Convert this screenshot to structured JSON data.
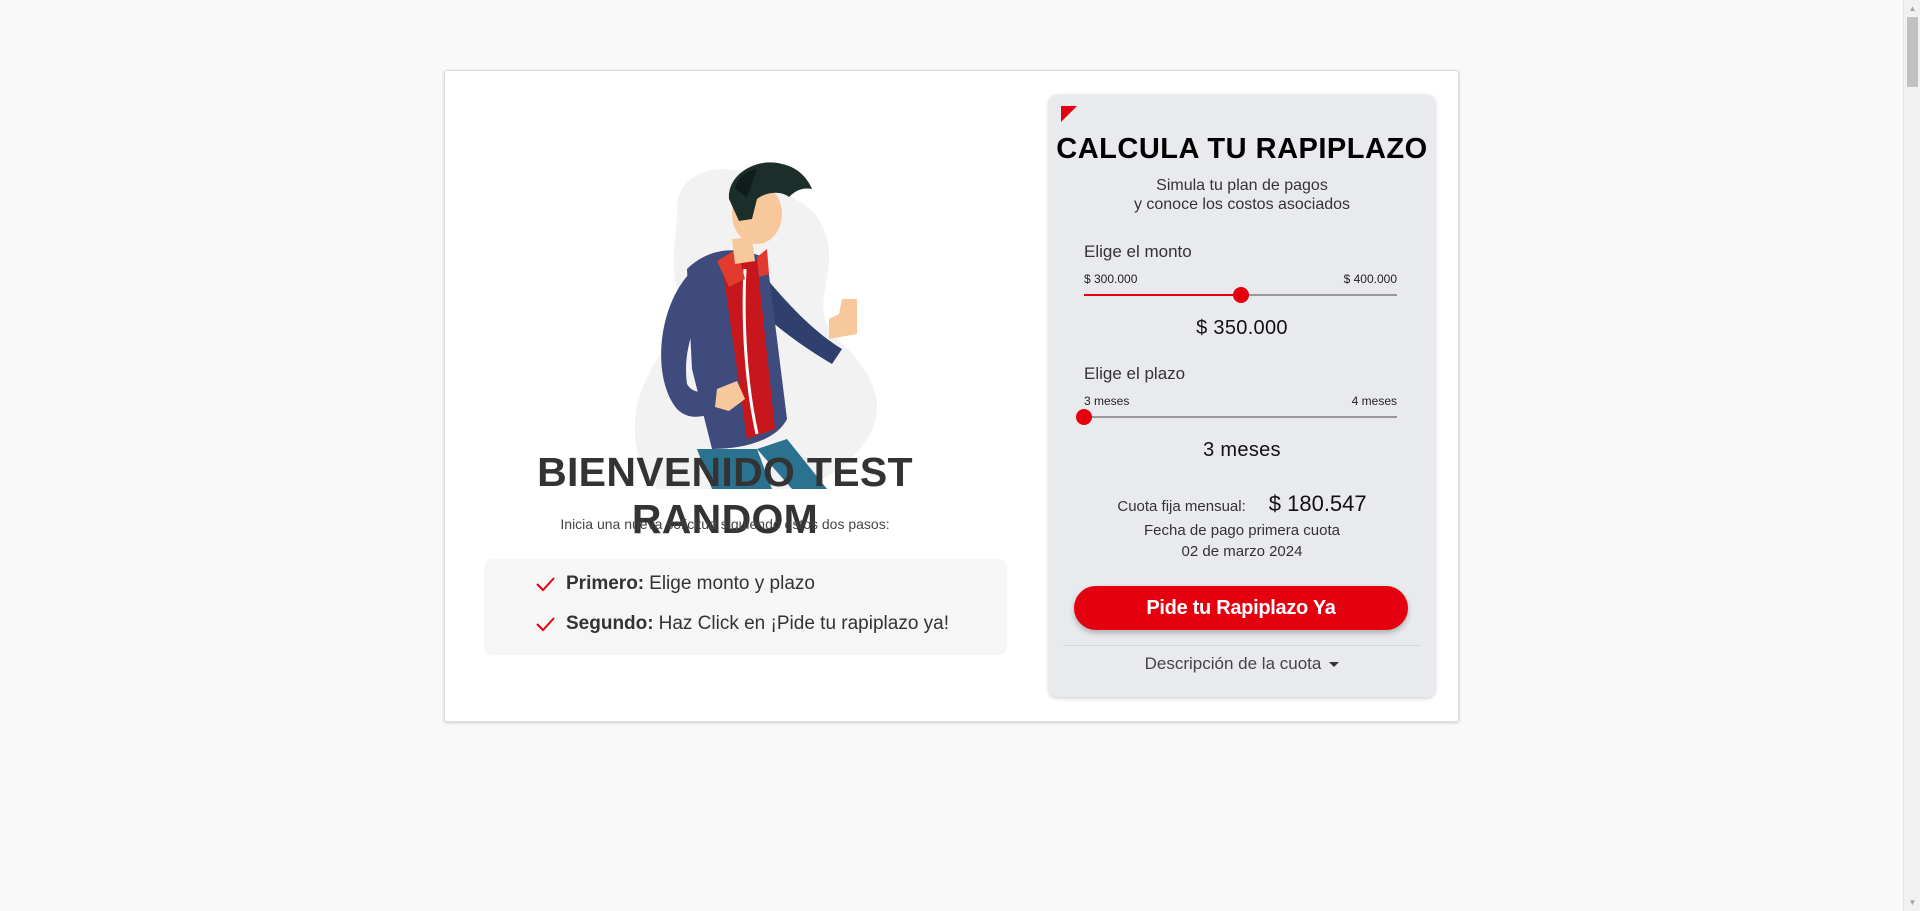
{
  "welcome": {
    "title": "BIENVENIDO TEST RANDOM",
    "subtitle": "Inicia una nueva solicitud siguiendo estos dos pasos:",
    "steps": [
      {
        "bold": "Primero:",
        "text": "Elige monto y plazo",
        "icon": "check-icon"
      },
      {
        "bold": "Segundo:",
        "text": "Haz Click en ¡Pide tu rapiplazo ya!",
        "icon": "check-icon"
      }
    ]
  },
  "calculator": {
    "title": "CALCULA TU RAPIPLAZO",
    "subtitle_line1": "Simula tu plan de pagos",
    "subtitle_line2": "y conoce los costos asociados",
    "amount": {
      "label": "Elige el monto",
      "min_label": "$ 300.000",
      "max_label": "$ 400.000",
      "value_label": "$ 350.000",
      "fraction": 0.5
    },
    "term": {
      "label": "Elige el plazo",
      "min_label": "3 meses",
      "max_label": "4 meses",
      "value_label": "3 meses",
      "fraction": 0.0
    },
    "cuota_label": "Cuota fija mensual:",
    "cuota_value": "$ 180.547",
    "fecha_label": "Fecha de pago primera cuota",
    "fecha_value": "02 de marzo 2024",
    "cta_label": "Pide tu Rapiplazo Ya",
    "description_toggle": "Descripción de la cuota"
  },
  "colors": {
    "accent": "#e4000f",
    "panel": "#e9eaee",
    "background": "#f9f9f9"
  }
}
